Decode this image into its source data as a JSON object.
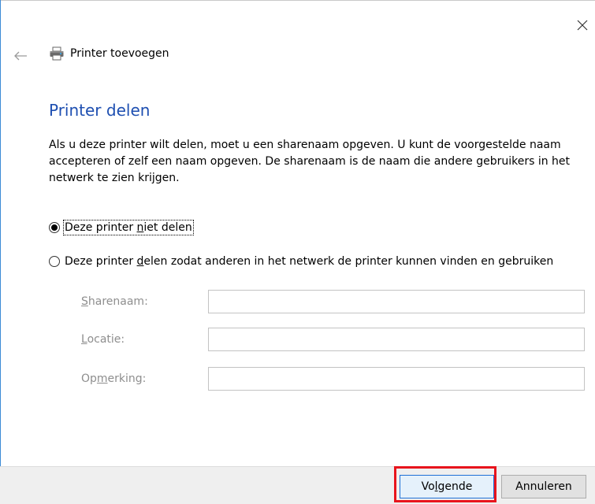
{
  "window": {
    "title": "Printer toevoegen",
    "close_icon": "close-icon",
    "back_icon": "back-arrow-icon",
    "title_icon": "printer-icon"
  },
  "page": {
    "heading": "Printer delen",
    "description": "Als u deze printer wilt delen, moet u een sharenaam opgeven. U kunt de voorgestelde naam accepteren of zelf een naam opgeven. De sharenaam is de naam die andere gebruikers in het netwerk te zien krijgen."
  },
  "options": {
    "no_share": {
      "pre": "Deze printer ",
      "u": "n",
      "post": "iet delen",
      "selected": true
    },
    "share": {
      "pre": "Deze printer ",
      "u": "d",
      "post": "elen zodat anderen in het netwerk de printer kunnen vinden en gebruiken",
      "selected": false
    }
  },
  "fields": {
    "share_name": {
      "u": "S",
      "rest": "harenaam:",
      "value": ""
    },
    "location": {
      "u": "L",
      "rest": "ocatie:",
      "value": ""
    },
    "comment": {
      "pre": "Op",
      "u": "m",
      "rest": "erking:",
      "value": ""
    }
  },
  "buttons": {
    "next": {
      "pre": "Vo",
      "u": "l",
      "post": "gende"
    },
    "cancel": "Annuleren"
  },
  "colors": {
    "heading": "#1e4fb1",
    "highlight": "#e8141c",
    "footer": "#efefef"
  }
}
